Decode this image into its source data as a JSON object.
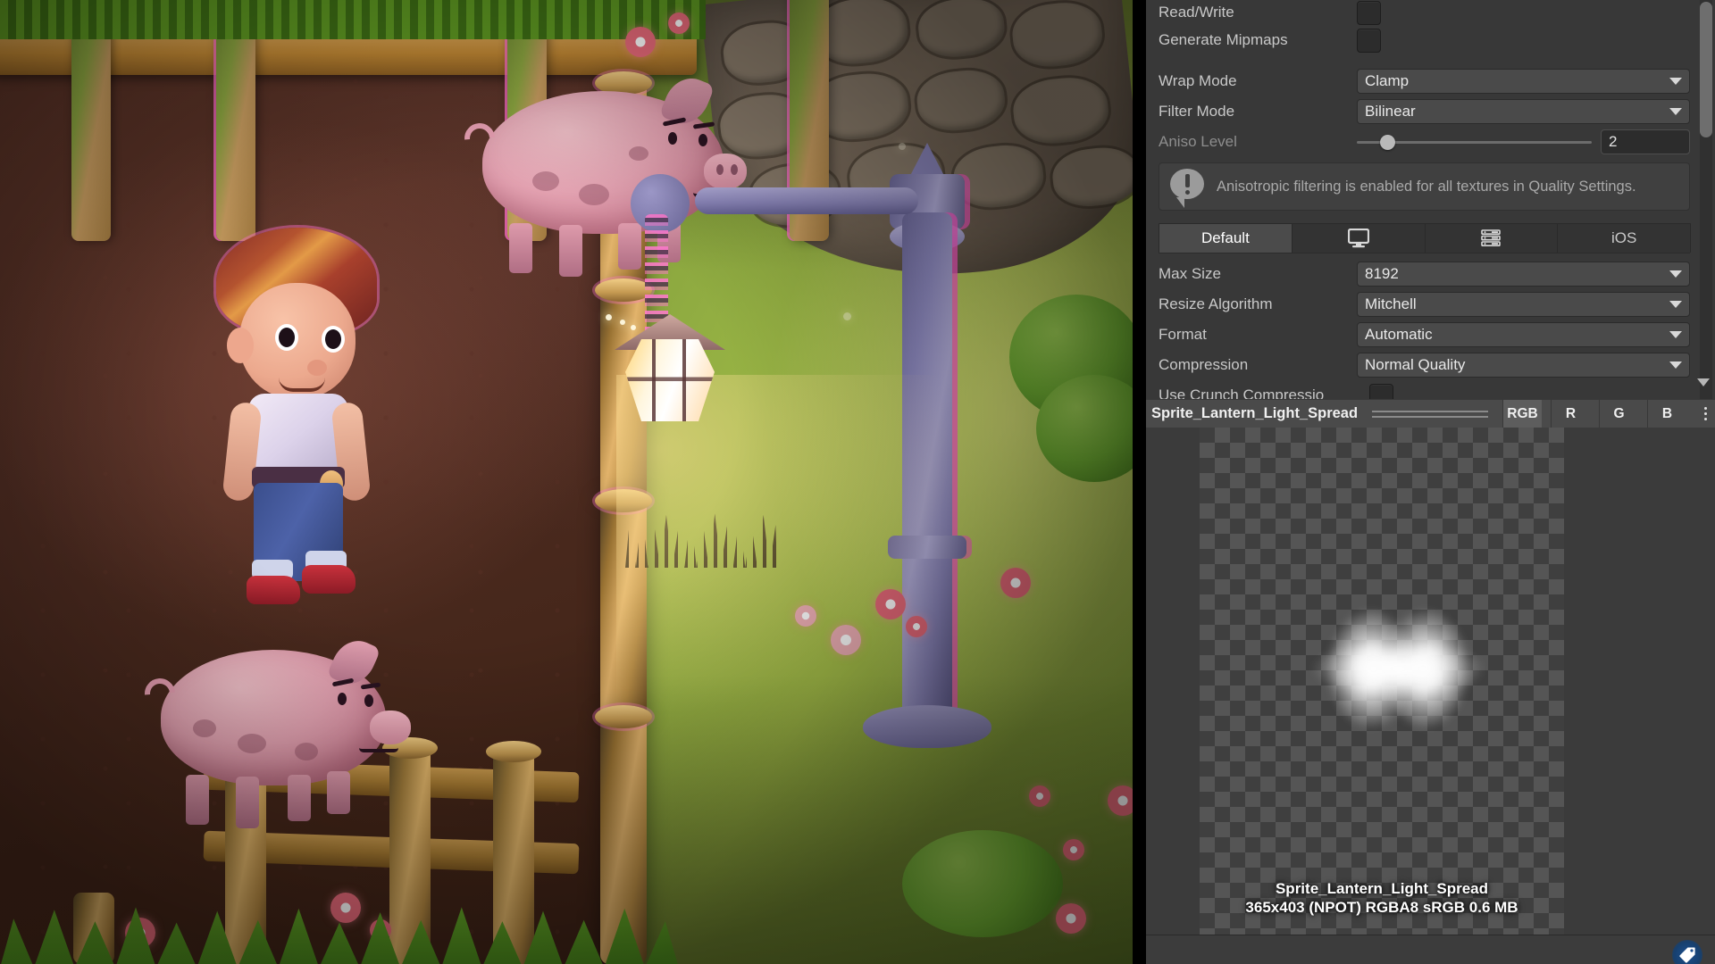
{
  "inspector": {
    "properties": [
      {
        "name": "read-write",
        "label": "Read/Write",
        "type": "checkbox",
        "value": false
      },
      {
        "name": "generate-mipmaps",
        "label": "Generate Mipmaps",
        "type": "checkbox",
        "value": false
      },
      {
        "name": "wrap-mode",
        "label": "Wrap Mode",
        "type": "dropdown",
        "value": "Clamp"
      },
      {
        "name": "filter-mode",
        "label": "Filter Mode",
        "type": "dropdown",
        "value": "Bilinear"
      },
      {
        "name": "aniso-level",
        "label": "Aniso Level",
        "type": "slider",
        "value": "2",
        "disabled": true
      }
    ],
    "help_box": {
      "icon": "info-icon",
      "text": "Anisotropic filtering is enabled for all textures in Quality Settings."
    },
    "platform_tabs": [
      {
        "name": "tab-default",
        "label": "Default",
        "icon": "",
        "active": true
      },
      {
        "name": "tab-standalone",
        "label": "",
        "icon": "monitor-icon",
        "active": false
      },
      {
        "name": "tab-android",
        "label": "",
        "icon": "android-icon",
        "active": false
      },
      {
        "name": "tab-ios",
        "label": "iOS",
        "icon": "",
        "active": false
      }
    ],
    "platform_settings": [
      {
        "name": "max-size",
        "label": "Max Size",
        "type": "dropdown",
        "value": "8192"
      },
      {
        "name": "resize-algorithm",
        "label": "Resize Algorithm",
        "type": "dropdown",
        "value": "Mitchell"
      },
      {
        "name": "format",
        "label": "Format",
        "type": "dropdown",
        "value": "Automatic"
      },
      {
        "name": "compression",
        "label": "Compression",
        "type": "dropdown",
        "value": "Normal Quality"
      },
      {
        "name": "use-crunch-compression",
        "label": "Use Crunch Compressio",
        "type": "checkbox",
        "value": false
      }
    ]
  },
  "preview": {
    "title": "Sprite_Lantern_Light_Spread",
    "channel_buttons": [
      {
        "name": "channel-rgb",
        "label": "RGB",
        "active": true
      },
      {
        "name": "channel-r",
        "label": "R",
        "active": false
      },
      {
        "name": "channel-g",
        "label": "G",
        "active": false
      },
      {
        "name": "channel-b",
        "label": "B",
        "active": false
      }
    ],
    "menu_icon": "kebab-menu-icon",
    "caption_name": "Sprite_Lantern_Light_Spread",
    "caption_info": "365x403 (NPOT)  RGBA8 sRGB   0.6 MB"
  },
  "status_bar": {
    "badge_icon": "tag-icon"
  },
  "game_view": {
    "scene_name": "farm-pen-night-scene",
    "colors": {
      "dirt": "#4e2c22",
      "lawn": "#a8c24a",
      "lamp_metal": "#8c87bd",
      "lamp_rim": "#ff5ac8",
      "lantern_glow": "#ffe19a",
      "pig": "#e4a3b2"
    },
    "entities": [
      {
        "name": "boy-character",
        "label": "Boy character"
      },
      {
        "name": "pig-upper",
        "label": "Pig"
      },
      {
        "name": "pig-lower",
        "label": "Pig"
      },
      {
        "name": "street-lamp",
        "label": "Street lamp"
      },
      {
        "name": "hanging-lantern",
        "label": "Hanging lantern"
      },
      {
        "name": "wooden-fence",
        "label": "Wooden fence"
      }
    ]
  }
}
